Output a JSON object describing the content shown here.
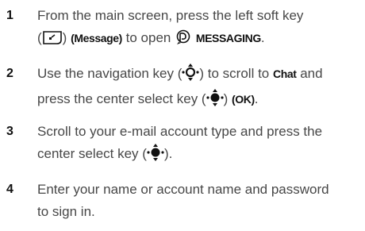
{
  "steps": [
    {
      "number": "1",
      "line1_a": "From the main screen, press the left soft key",
      "line2_a": "(",
      "line2_b": ") ",
      "line2_c": "(Message)",
      "line2_d": " to open ",
      "line2_e": "MESSAGING",
      "line2_f": "."
    },
    {
      "number": "2",
      "line1_a": "Use the navigation key (",
      "line1_b": ") to scroll to ",
      "line1_c": "Chat",
      "line1_d": " and",
      "line2_a": "press the center select key (",
      "line2_b": ") ",
      "line2_c": "(OK)",
      "line2_d": "."
    },
    {
      "number": "3",
      "line1_a": "Scroll to your e-mail account type and press the",
      "line2_a": "center select key (",
      "line2_b": ")."
    },
    {
      "number": "4",
      "line1_a": "Enter your name or account name and password",
      "line2_a": "to sign in."
    }
  ],
  "icons": {
    "soft_key": "left-soft-key-icon",
    "messaging": "messaging-icon",
    "nav_key": "navigation-key-icon",
    "center_key": "center-select-key-icon"
  }
}
